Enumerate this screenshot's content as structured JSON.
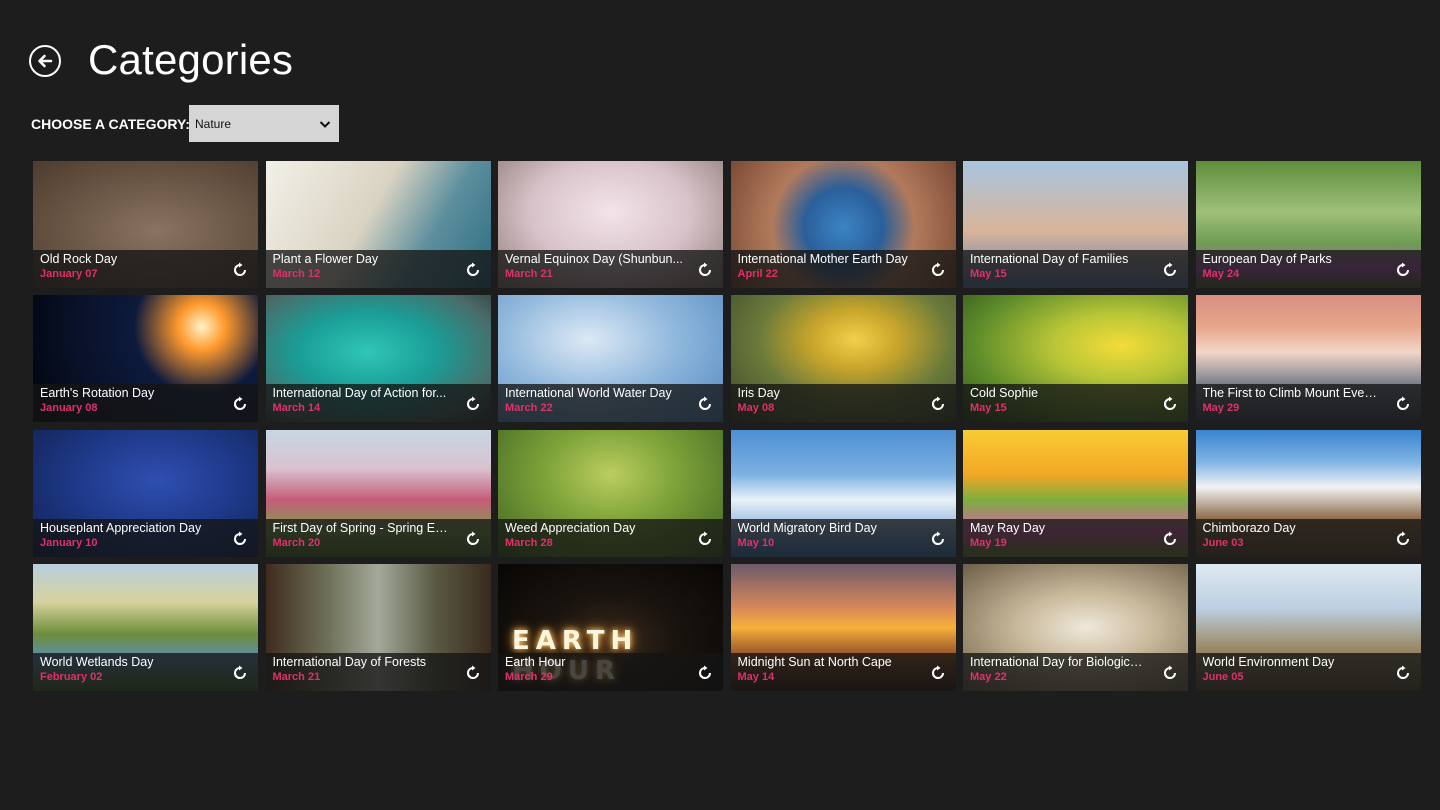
{
  "header": {
    "title": "Categories"
  },
  "filter": {
    "label": "CHOOSE A CATEGORY:",
    "selected": "Nature"
  },
  "tiles": [
    {
      "title": "Old Rock Day",
      "date": "January 07"
    },
    {
      "title": "Plant a Flower Day",
      "date": "March 12"
    },
    {
      "title": "Vernal Equinox Day (Shunbun...",
      "date": "March 21"
    },
    {
      "title": "International Mother Earth Day",
      "date": "April 22"
    },
    {
      "title": "International Day of Families",
      "date": "May 15"
    },
    {
      "title": "European Day of Parks",
      "date": "May 24"
    },
    {
      "title": "Earth's Rotation Day",
      "date": "January 08"
    },
    {
      "title": "International Day of Action for...",
      "date": "March 14"
    },
    {
      "title": "International World Water Day",
      "date": "March 22"
    },
    {
      "title": "Iris Day",
      "date": "May 08"
    },
    {
      "title": "Cold Sophie",
      "date": "May 15"
    },
    {
      "title": "The First to Climb Mount Everest",
      "date": "May 29"
    },
    {
      "title": "Houseplant Appreciation Day",
      "date": "January 10"
    },
    {
      "title": "First Day of Spring - Spring Eq...",
      "date": "March 20"
    },
    {
      "title": "Weed Appreciation Day",
      "date": "March 28"
    },
    {
      "title": "World Migratory Bird Day",
      "date": "May 10"
    },
    {
      "title": "May Ray Day",
      "date": "May 19"
    },
    {
      "title": "Chimborazo Day",
      "date": "June 03"
    },
    {
      "title": "World Wetlands Day",
      "date": "February 02"
    },
    {
      "title": "International Day of Forests",
      "date": "March 21"
    },
    {
      "title": "Earth Hour",
      "date": "March 29"
    },
    {
      "title": "Midnight Sun at North Cape",
      "date": "May 14"
    },
    {
      "title": "International Day for Biological...",
      "date": "May 22"
    },
    {
      "title": "World Environment Day",
      "date": "June 05"
    }
  ],
  "earth_hour_art": "EARTH HOUR",
  "colors": {
    "background": "#1d1d1d",
    "date_accent": "#e0306b",
    "dropdown_bg": "#d6d6d6"
  },
  "icons": {
    "back": "back-arrow-circle-icon",
    "dropdown": "chevron-down-icon",
    "tile_action": "refresh-icon"
  }
}
